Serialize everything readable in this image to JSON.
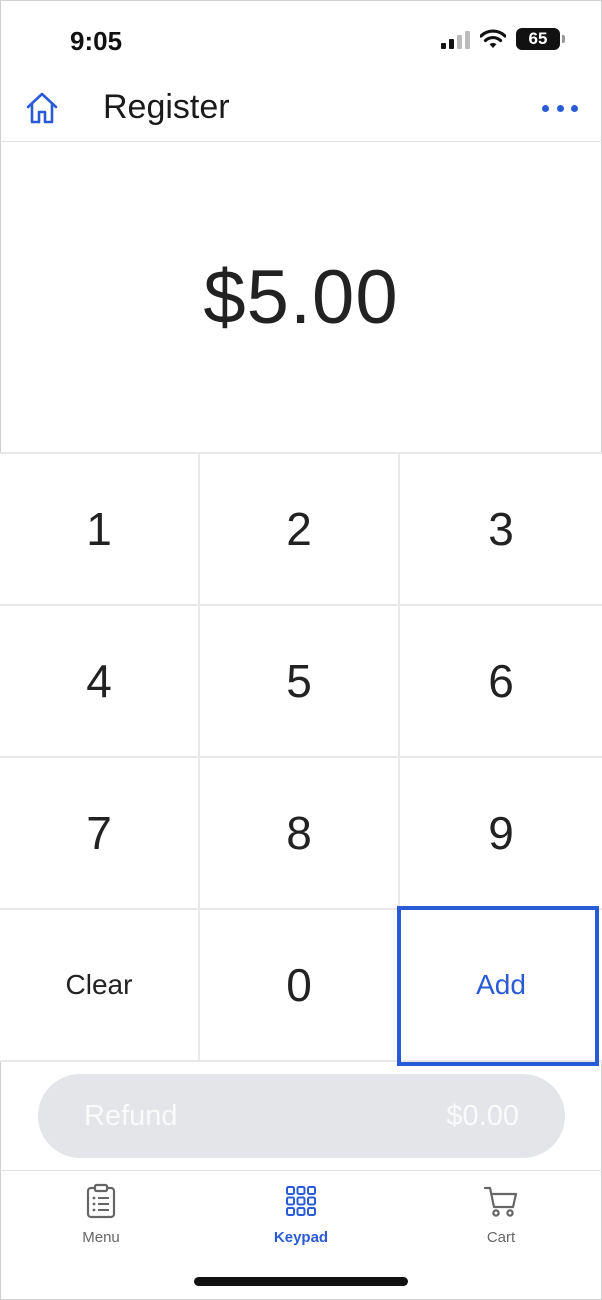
{
  "status_bar": {
    "time": "9:05",
    "battery": "65"
  },
  "header": {
    "title": "Register"
  },
  "amount": "$5.00",
  "keypad": {
    "keys": [
      "1",
      "2",
      "3",
      "4",
      "5",
      "6",
      "7",
      "8",
      "9",
      "Clear",
      "0",
      "Add"
    ]
  },
  "refund": {
    "label": "Refund",
    "amount": "$0.00"
  },
  "tabs": [
    {
      "label": "Menu",
      "icon": "clipboard-list-icon",
      "active": false
    },
    {
      "label": "Keypad",
      "icon": "grid-icon",
      "active": true
    },
    {
      "label": "Cart",
      "icon": "cart-icon",
      "active": false
    }
  ],
  "colors": {
    "accent": "#2a5bd7",
    "refund_bg": "#e3e5e8"
  }
}
